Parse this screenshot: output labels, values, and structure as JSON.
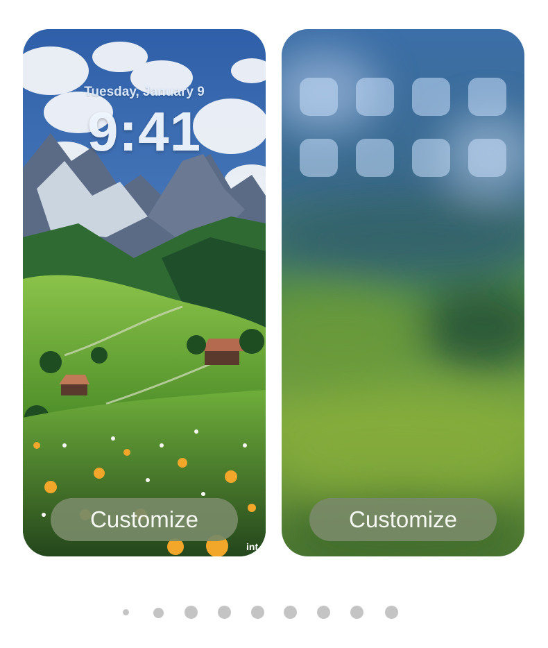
{
  "lock_screen": {
    "date": "Tuesday, January 9",
    "time": "9:41",
    "customize_label": "Customize",
    "watermark": "int"
  },
  "home_screen": {
    "customize_label": "Customize",
    "app_icon_count": 8
  },
  "pager": {
    "page_count": 9,
    "current_page": 1
  },
  "colors": {
    "button_bg": "#788a68",
    "button_text": "#f6f8f2",
    "page_dot": "#c4c4c4"
  }
}
